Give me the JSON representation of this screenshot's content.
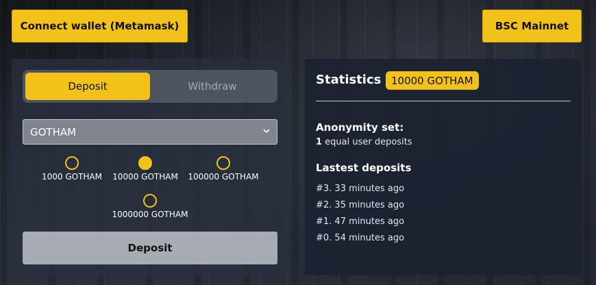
{
  "header": {
    "connect_label": "Connect wallet (Metamask)",
    "network_label": "BSC Mainnet"
  },
  "deposit_panel": {
    "tabs": [
      {
        "label": "Deposit",
        "active": true
      },
      {
        "label": "Withdraw",
        "active": false
      }
    ],
    "token_select": {
      "value": "GOTHAM"
    },
    "amounts": [
      {
        "label": "1000 GOTHAM",
        "selected": false
      },
      {
        "label": "10000 GOTHAM",
        "selected": true
      },
      {
        "label": "100000 GOTHAM",
        "selected": false
      },
      {
        "label": "1000000 GOTHAM",
        "selected": false
      }
    ],
    "submit_label": "Deposit"
  },
  "statistics": {
    "title": "Statistics",
    "badge": "10000 GOTHAM",
    "anonymity_title": "Anonymity set:",
    "anonymity_count": "1",
    "anonymity_suffix": " equal user deposits",
    "latest_title": "Lastest deposits",
    "latest": [
      "#3. 33 minutes ago",
      "#2. 35 minutes ago",
      "#1. 47 minutes ago",
      "#0. 54 minutes ago"
    ]
  },
  "colors": {
    "accent": "#f3c21a",
    "panel": "#28303e",
    "button_disabled": "#a7abb2"
  },
  "icons": {
    "select_chevron": "chevron-down-icon"
  }
}
